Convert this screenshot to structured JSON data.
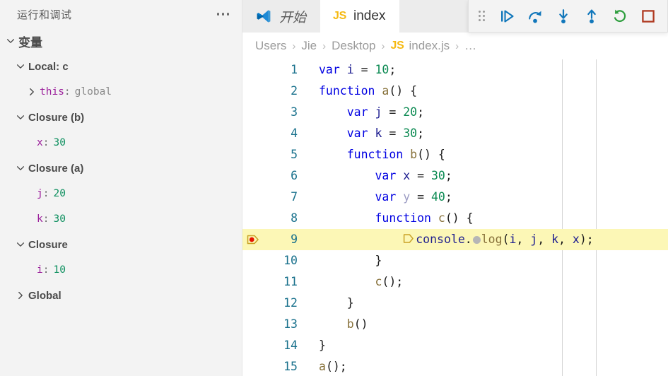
{
  "sidebar": {
    "title": "运行和调试",
    "kebab_icon": "more-actions-icon",
    "variables_section": {
      "label": "变量",
      "expanded": true
    },
    "scopes": [
      {
        "id": "local-c",
        "label": "Local: c",
        "expanded": true,
        "items": [
          {
            "name": "this",
            "separator": ":",
            "value": "global",
            "value_kind": "string",
            "expandable": true
          }
        ]
      },
      {
        "id": "closure-b",
        "label": "Closure (b)",
        "expanded": true,
        "items": [
          {
            "name": "x",
            "separator": ":",
            "value": "30",
            "value_kind": "number",
            "expandable": false
          }
        ]
      },
      {
        "id": "closure-a",
        "label": "Closure (a)",
        "expanded": true,
        "items": [
          {
            "name": "j",
            "separator": ":",
            "value": "20",
            "value_kind": "number",
            "expandable": false
          },
          {
            "name": "k",
            "separator": ":",
            "value": "30",
            "value_kind": "number",
            "expandable": false
          }
        ]
      },
      {
        "id": "closure",
        "label": "Closure",
        "expanded": true,
        "items": [
          {
            "name": "i",
            "separator": ":",
            "value": "10",
            "value_kind": "number",
            "expandable": false
          }
        ]
      },
      {
        "id": "global",
        "label": "Global",
        "expanded": false,
        "items": []
      }
    ]
  },
  "tabs": [
    {
      "id": "welcome",
      "label": "开始",
      "icon": "vscode-logo-icon",
      "active": false
    },
    {
      "id": "index-js",
      "label": "index",
      "icon": "js-file-icon",
      "active": true
    }
  ],
  "debug_toolbar": {
    "grip_icon": "drag-handle-icon",
    "buttons": [
      {
        "id": "continue",
        "label": "继续",
        "icon": "continue-icon",
        "color": "#1177bb"
      },
      {
        "id": "step-over",
        "label": "单步跳过",
        "icon": "step-over-icon",
        "color": "#1177bb"
      },
      {
        "id": "step-into",
        "label": "单步调试",
        "icon": "step-into-icon",
        "color": "#1177bb"
      },
      {
        "id": "step-out",
        "label": "单步跳出",
        "icon": "step-out-icon",
        "color": "#1177bb"
      },
      {
        "id": "restart",
        "label": "重启",
        "icon": "restart-icon",
        "color": "#2e9e3e"
      },
      {
        "id": "stop",
        "label": "停止",
        "icon": "stop-icon",
        "color": "#b03a22"
      }
    ]
  },
  "breadcrumb": {
    "separator": "›",
    "items": [
      {
        "label": "Users",
        "icon": null
      },
      {
        "label": "Jie",
        "icon": null
      },
      {
        "label": "Desktop",
        "icon": null
      },
      {
        "label": "index.js",
        "icon": "js-file-icon"
      },
      {
        "label": "…",
        "icon": null
      }
    ]
  },
  "editor": {
    "breakpoint_line": 9,
    "current_line": 9,
    "breakpoint_icon": "breakpoint-current-icon",
    "inline_breakpoint_icon": "inline-breakpoint-icon",
    "inline_candidate_icon": "inline-breakpoint-candidate-icon",
    "lines": [
      {
        "n": "1",
        "tokens": [
          {
            "t": "var ",
            "c": "kw"
          },
          {
            "t": "i",
            "c": "id"
          },
          {
            "t": " = ",
            "c": "punc"
          },
          {
            "t": "10",
            "c": "num"
          },
          {
            "t": ";",
            "c": "punc"
          }
        ]
      },
      {
        "n": "2",
        "tokens": [
          {
            "t": "function ",
            "c": "kw"
          },
          {
            "t": "a",
            "c": "fn"
          },
          {
            "t": "() {",
            "c": "punc"
          }
        ]
      },
      {
        "n": "3",
        "tokens": [
          {
            "t": "    var ",
            "c": "kw"
          },
          {
            "t": "j",
            "c": "id"
          },
          {
            "t": " = ",
            "c": "punc"
          },
          {
            "t": "20",
            "c": "num"
          },
          {
            "t": ";",
            "c": "punc"
          }
        ]
      },
      {
        "n": "4",
        "tokens": [
          {
            "t": "    var ",
            "c": "kw"
          },
          {
            "t": "k",
            "c": "id"
          },
          {
            "t": " = ",
            "c": "punc"
          },
          {
            "t": "30",
            "c": "num"
          },
          {
            "t": ";",
            "c": "punc"
          }
        ]
      },
      {
        "n": "5",
        "tokens": [
          {
            "t": "    function ",
            "c": "kw"
          },
          {
            "t": "b",
            "c": "fn"
          },
          {
            "t": "() {",
            "c": "punc"
          }
        ]
      },
      {
        "n": "6",
        "tokens": [
          {
            "t": "        var ",
            "c": "kw"
          },
          {
            "t": "x",
            "c": "id"
          },
          {
            "t": " = ",
            "c": "punc"
          },
          {
            "t": "30",
            "c": "num"
          },
          {
            "t": ";",
            "c": "punc"
          }
        ]
      },
      {
        "n": "7",
        "tokens": [
          {
            "t": "        var ",
            "c": "kw"
          },
          {
            "t": "y",
            "c": "dim"
          },
          {
            "t": " = ",
            "c": "punc"
          },
          {
            "t": "40",
            "c": "num"
          },
          {
            "t": ";",
            "c": "punc"
          }
        ]
      },
      {
        "n": "8",
        "tokens": [
          {
            "t": "        function ",
            "c": "kw"
          },
          {
            "t": "c",
            "c": "fn"
          },
          {
            "t": "() {",
            "c": "punc"
          }
        ]
      },
      {
        "n": "9",
        "highlight": true,
        "indent": 12,
        "inline_markers": true,
        "tokens": [
          {
            "t": "console",
            "c": "obj"
          },
          {
            "t": ".",
            "c": "punc"
          },
          {
            "t": "__DOT__",
            "c": "dot"
          },
          {
            "t": "log",
            "c": "fn"
          },
          {
            "t": "(",
            "c": "punc"
          },
          {
            "t": "i",
            "c": "id"
          },
          {
            "t": ", ",
            "c": "punc"
          },
          {
            "t": "j",
            "c": "id"
          },
          {
            "t": ", ",
            "c": "punc"
          },
          {
            "t": "k",
            "c": "id"
          },
          {
            "t": ", ",
            "c": "punc"
          },
          {
            "t": "x",
            "c": "id"
          },
          {
            "t": ");",
            "c": "punc"
          }
        ]
      },
      {
        "n": "10",
        "tokens": [
          {
            "t": "        }",
            "c": "punc"
          }
        ]
      },
      {
        "n": "11",
        "tokens": [
          {
            "t": "        ",
            "c": "punc"
          },
          {
            "t": "c",
            "c": "fn"
          },
          {
            "t": "();",
            "c": "punc"
          }
        ]
      },
      {
        "n": "12",
        "tokens": [
          {
            "t": "    }",
            "c": "punc"
          }
        ]
      },
      {
        "n": "13",
        "tokens": [
          {
            "t": "    ",
            "c": "punc"
          },
          {
            "t": "b",
            "c": "fn"
          },
          {
            "t": "()",
            "c": "punc"
          }
        ]
      },
      {
        "n": "14",
        "tokens": [
          {
            "t": "}",
            "c": "punc"
          }
        ]
      },
      {
        "n": "15",
        "tokens": [
          {
            "t": "",
            "c": "punc"
          },
          {
            "t": "a",
            "c": "fn"
          },
          {
            "t": "();",
            "c": "punc"
          }
        ]
      }
    ]
  },
  "colors": {
    "highlight_line": "#fcf7b6",
    "breakpoint_red": "#e51400",
    "breakpoint_gold": "#c9a227",
    "line_number": "#19718c",
    "accent_blue": "#1177bb",
    "restart_green": "#2e9e3e",
    "stop_red": "#b03a22"
  }
}
